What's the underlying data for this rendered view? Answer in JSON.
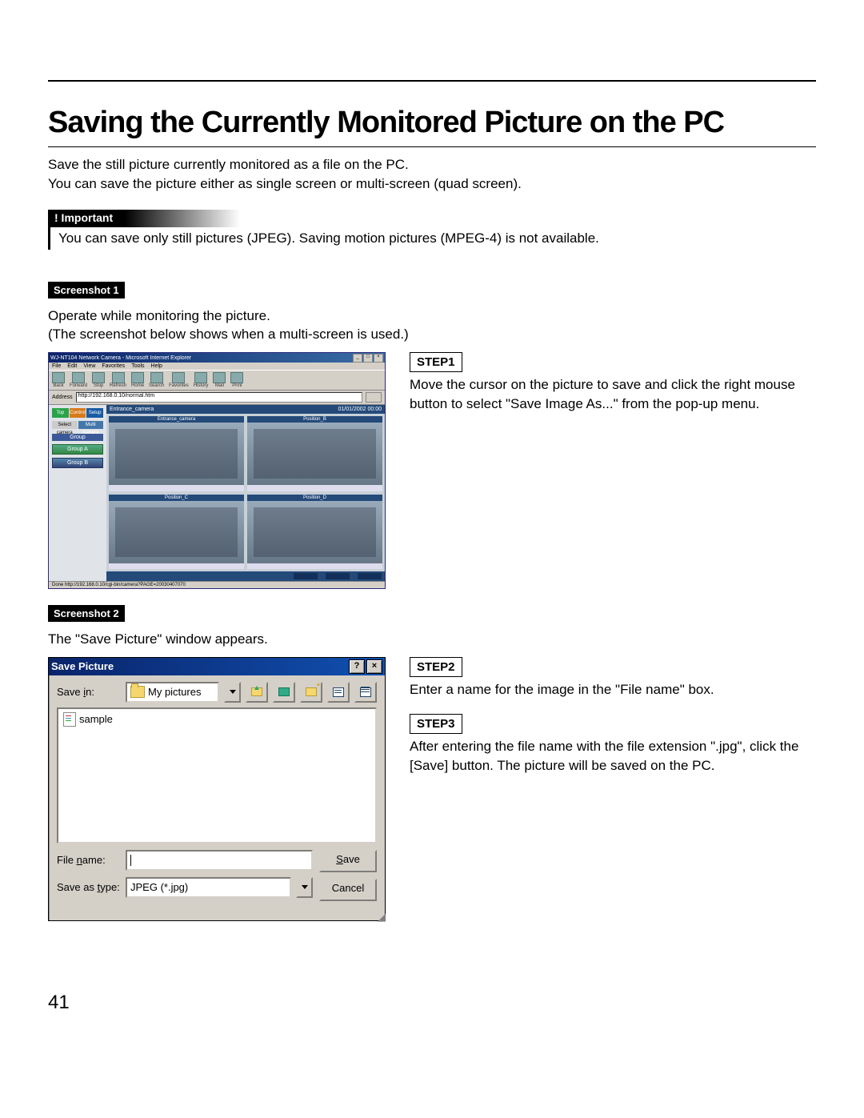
{
  "page_number": "41",
  "title": "Saving the Currently Monitored Picture on the PC",
  "intro_l1": "Save the still picture currently monitored as a file on the PC.",
  "intro_l2": "You can save the picture either as single screen or multi-screen (quad screen).",
  "important": {
    "header": "! Important",
    "body": "You can save only still pictures (JPEG). Saving motion pictures (MPEG-4) is not available."
  },
  "screenshots": {
    "s1": {
      "tag": "Screenshot 1",
      "desc_l1": "Operate while monitoring the picture.",
      "desc_l2": "(The screenshot below shows when a multi-screen is used.)"
    },
    "s2": {
      "tag": "Screenshot 2",
      "desc": "The \"Save Picture\" window appears."
    }
  },
  "steps": {
    "step1": {
      "tag": "STEP1",
      "text": "Move the cursor on the picture to save and click the right mouse button to select \"Save Image As...\" from the pop-up menu."
    },
    "step2": {
      "tag": "STEP2",
      "text": "Enter a name for the image in the \"File name\" box."
    },
    "step3": {
      "tag": "STEP3",
      "text": "After entering the file name with the file extension \".jpg\", click the [Save] button. The picture will be saved on the PC."
    }
  },
  "browser": {
    "title": "WJ-NT104 Network Camera - Microsoft Internet Explorer",
    "menus": [
      "File",
      "Edit",
      "View",
      "Favorites",
      "Tools",
      "Help"
    ],
    "tools": [
      "Back",
      "Forward",
      "Stop",
      "Refresh",
      "Home",
      "Search",
      "Favorites",
      "History",
      "Mail",
      "Print"
    ],
    "address_label": "Address",
    "address_value": "http://192.168.0.10/normal.htm",
    "side_tabs": [
      "Top",
      "Control",
      "Setup"
    ],
    "side_subtabs": [
      "Select camera",
      "Multi camera"
    ],
    "group_header": "Group",
    "groups": [
      "Group A",
      "Group B"
    ],
    "main_title": "Entrance_camera",
    "main_time": "01/01/2002  00:00",
    "cam_labels": [
      "Entrance_camera",
      "Position_B",
      "Position_C",
      "Position_D"
    ],
    "status": "Done                                                    http://192.168.0.10/cgi-bin/camera?PAGE=20030407070"
  },
  "save_dialog": {
    "title": "Save Picture",
    "help": "?",
    "close": "×",
    "save_in_label": "Save in:",
    "save_in_value": "My pictures",
    "file_item": "sample",
    "file_name_label_pre": "File ",
    "file_name_label_ul": "n",
    "file_name_label_post": "ame:",
    "file_name_value": "",
    "save_as_type_label_pre": "Save as ",
    "save_as_type_label_ul": "t",
    "save_as_type_label_post": "ype:",
    "save_as_type_value": "JPEG (*.jpg)",
    "save_btn_ul": "S",
    "save_btn_post": "ave",
    "cancel_btn": "Cancel"
  }
}
